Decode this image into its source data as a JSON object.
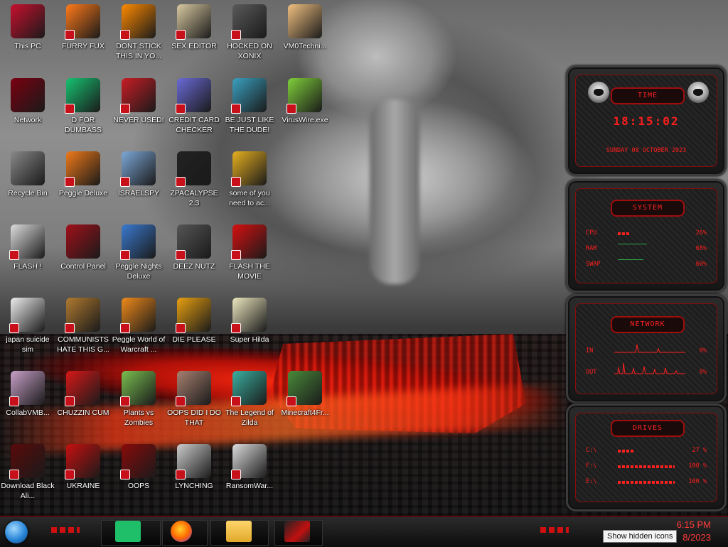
{
  "desktop": {
    "icons": [
      {
        "label": "This PC",
        "icon": "computer-icon"
      },
      {
        "label": "FURRY FUX",
        "icon": "firefox-icon"
      },
      {
        "label": "DONT STICK THIS IN YO...",
        "icon": "vlc-cone-icon"
      },
      {
        "label": "SEX EDITOR",
        "icon": "hxd-editor-icon"
      },
      {
        "label": "HOCKED ON XONIX",
        "icon": "xonix-game-icon"
      },
      {
        "label": "VM0Techni...",
        "icon": "user-avatar-icon"
      },
      {
        "label": "Network",
        "icon": "alien-network-icon"
      },
      {
        "label": "D FOR DUMBASS",
        "icon": "chat-app-icon"
      },
      {
        "label": "NEVER USED!",
        "icon": "devcpp-icon"
      },
      {
        "label": "CREDIT CARD CHECKER",
        "icon": "credit-card-icon"
      },
      {
        "label": "BE JUST LIKE THE DUDE!",
        "icon": "santa-icon"
      },
      {
        "label": "VirusWire.exe",
        "icon": "limewire-icon"
      },
      {
        "label": "Recycle Bin",
        "icon": "recycle-bin-icon"
      },
      {
        "label": "Peggle Deluxe",
        "icon": "peggle-icon"
      },
      {
        "label": "ISRAELSPY",
        "icon": "network-spy-icon"
      },
      {
        "label": "ZPACALYPSE 2.3",
        "icon": "terminal-icon"
      },
      {
        "label": "some of you need to ac...",
        "icon": "cartoon-dog-icon"
      },
      {
        "label": "FLASH !",
        "icon": "document-icon"
      },
      {
        "label": "Control Panel",
        "icon": "control-panel-icon"
      },
      {
        "label": "Peggle Nights Deluxe",
        "icon": "peggle-nights-icon"
      },
      {
        "label": "DEEZ NUTZ",
        "icon": "stacked-windows-icon"
      },
      {
        "label": "FLASH THE MOVIE",
        "icon": "flash-player-icon"
      },
      {
        "label": "japan suicide sim",
        "icon": "japan-sim-icon"
      },
      {
        "label": "COMMUNISTS HATE THIS G...",
        "icon": "money-bag-icon"
      },
      {
        "label": "Peggle World of Warcraft ...",
        "icon": "peggle-wow-icon"
      },
      {
        "label": "DIE PLEASE",
        "icon": "director-icon"
      },
      {
        "label": "Super Hilda",
        "icon": "pixel-character-icon"
      },
      {
        "label": "CollabVMB...",
        "icon": "monitor-app-icon"
      },
      {
        "label": "CHUZZIN CUM",
        "icon": "chuzzle-icon"
      },
      {
        "label": "Plants vs Zombies",
        "icon": "sunflower-icon"
      },
      {
        "label": "OOPS DID I DO THAT",
        "icon": "portrait-icon"
      },
      {
        "label": "The Legend of Zilda",
        "icon": "pixel-hero-icon"
      },
      {
        "label": "Minecraft4Fr...",
        "icon": "minecraft-block-icon"
      },
      {
        "label": "Download Black Ali...",
        "icon": "alien-download-icon"
      },
      {
        "label": "UKRAINE",
        "icon": "radiation-icon"
      },
      {
        "label": "OOPS",
        "icon": "red-file-icon"
      },
      {
        "label": "LYNCHING",
        "icon": "flag-emblem-icon"
      },
      {
        "label": "RansomWar...",
        "icon": "skull-icon"
      }
    ]
  },
  "gadget": {
    "time": {
      "title": "TIME",
      "clock": "18:15:02",
      "date": "SUNDAY 08 OCTOBER 2023"
    },
    "system": {
      "title": "SYSTEM",
      "rows": [
        {
          "key": "CPU",
          "value": "26%",
          "level": 0.26
        },
        {
          "key": "RAM",
          "value": "68%",
          "level": 0.68
        },
        {
          "key": "SWAP",
          "value": "60%",
          "level": 0.6
        }
      ]
    },
    "network": {
      "title": "NETWORK",
      "in_label": "IN",
      "in_value": "0%",
      "out_label": "OUT",
      "out_value": "0%"
    },
    "drives": {
      "title": "DRIVES",
      "rows": [
        {
          "key": "C:\\",
          "value": "27 %",
          "level": 0.27
        },
        {
          "key": "F:\\",
          "value": "100 %",
          "level": 1.0
        },
        {
          "key": "E:\\",
          "value": "100 %",
          "level": 1.0
        }
      ]
    }
  },
  "taskbar": {
    "apps": [
      "chat-app-icon",
      "firefox-icon",
      "file-explorer-icon",
      "control-panel-icon"
    ],
    "clock_time": "6:15 PM",
    "clock_date": "8/2023",
    "tooltip": "Show hidden icons"
  },
  "colors": {
    "accent_red": "#ff1e1e",
    "gadget_bg": "#1d1d1d"
  }
}
